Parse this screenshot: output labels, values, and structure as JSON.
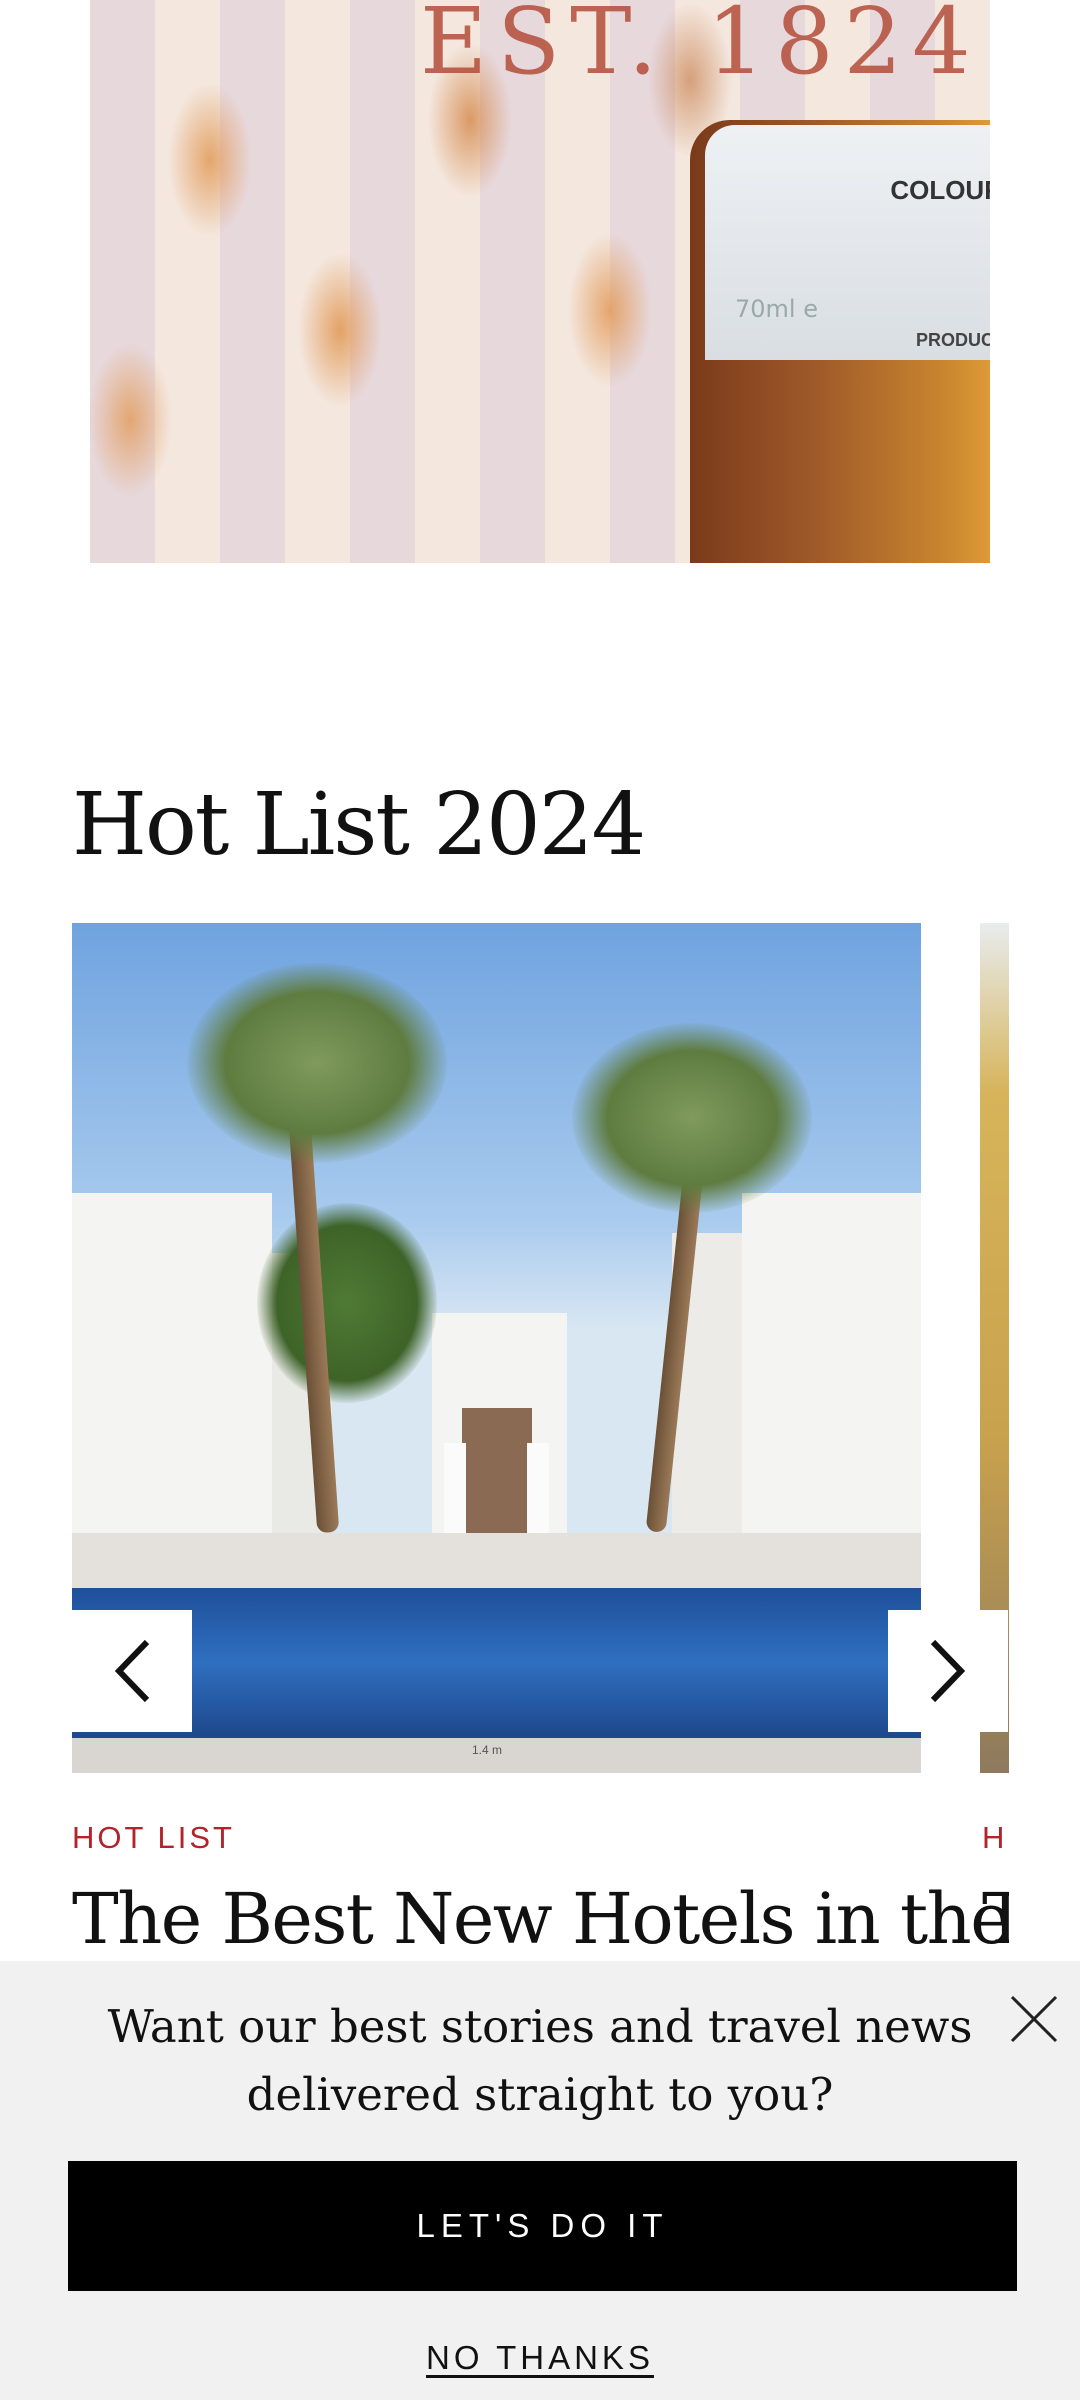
{
  "promo": {
    "est_text": "EST. 1824",
    "label_colour": "COLOUR",
    "label_volume": "70ml e",
    "label_product": "PRODUCT"
  },
  "section": {
    "title": "Hot List 2024"
  },
  "carousel": {
    "cards": [
      {
        "kicker": "HOT LIST",
        "headline": "The Best New Hotels in the",
        "pool_depth": "1.4 m"
      },
      {
        "kicker": "H",
        "headline": "T"
      }
    ],
    "prev_icon": "chevron-left-icon",
    "next_icon": "chevron-right-icon"
  },
  "newsletter": {
    "prompt": "Want our best stories and travel news delivered straight to you?",
    "cta_label": "LET'S DO IT",
    "dismiss_label": "NO THANKS",
    "close_icon": "close-icon"
  },
  "colors": {
    "kicker": "#b2232a",
    "cta_background": "#000000",
    "overlay_background": "#f1f1f1"
  }
}
